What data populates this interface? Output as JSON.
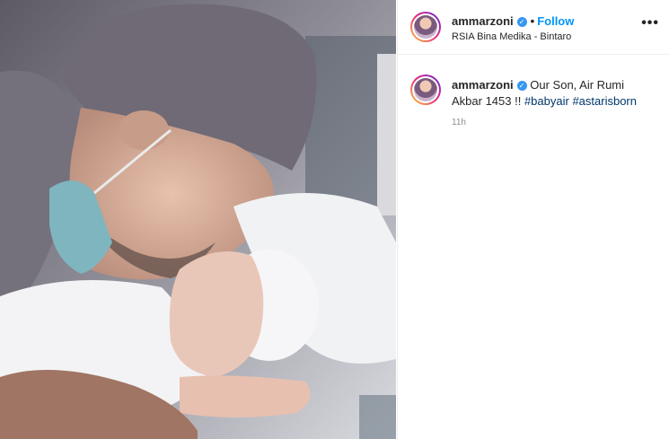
{
  "post": {
    "username": "ammarzoni",
    "verified_badge": "✓",
    "separator": "•",
    "follow_label": "Follow",
    "location": "RSIA Bina Medika - Bintaro",
    "more_icon": "•••",
    "caption_text": "Our Son, Air Rumi Akbar 1453 !!",
    "hashtags": [
      "#babyair",
      "#astarisborn"
    ],
    "timestamp": "11h"
  },
  "photo": {
    "icon": "photo-father-kissing-newborn"
  },
  "colors": {
    "accent": "#0095f6",
    "hashtag": "#00376b",
    "verified": "#3897f0",
    "muted": "#8e8e8e"
  }
}
